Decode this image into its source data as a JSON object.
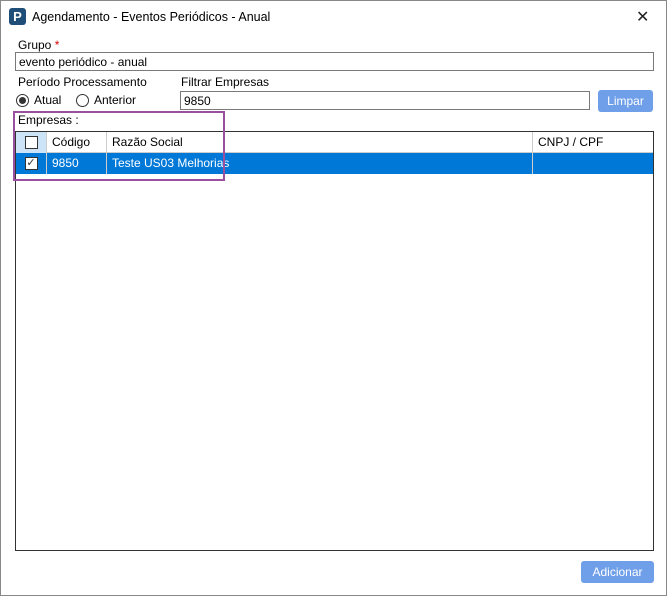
{
  "window": {
    "title": "Agendamento - Eventos Periódicos - Anual",
    "close": "✕",
    "logo": "P"
  },
  "grupo": {
    "label": "Grupo",
    "required_mark": "*",
    "value": "evento periódico - anual"
  },
  "periodo": {
    "label": "Período Processamento",
    "options": [
      {
        "label": "Atual",
        "selected": true
      },
      {
        "label": "Anterior",
        "selected": false
      }
    ]
  },
  "filtro": {
    "label": "Filtrar Empresas",
    "value": "9850",
    "clear_label": "Limpar"
  },
  "empresas": {
    "label": "Empresas :",
    "columns": [
      "Código",
      "Razão Social",
      "CNPJ / CPF"
    ],
    "rows": [
      {
        "checked": true,
        "codigo": "9850",
        "razao": "Teste US03 Melhorias",
        "cnpj": ""
      }
    ]
  },
  "footer": {
    "add_label": "Adicionar"
  },
  "colors": {
    "accent": "#0078d7",
    "highlight": "#9b4f9f",
    "button": "#6f9fe9"
  }
}
